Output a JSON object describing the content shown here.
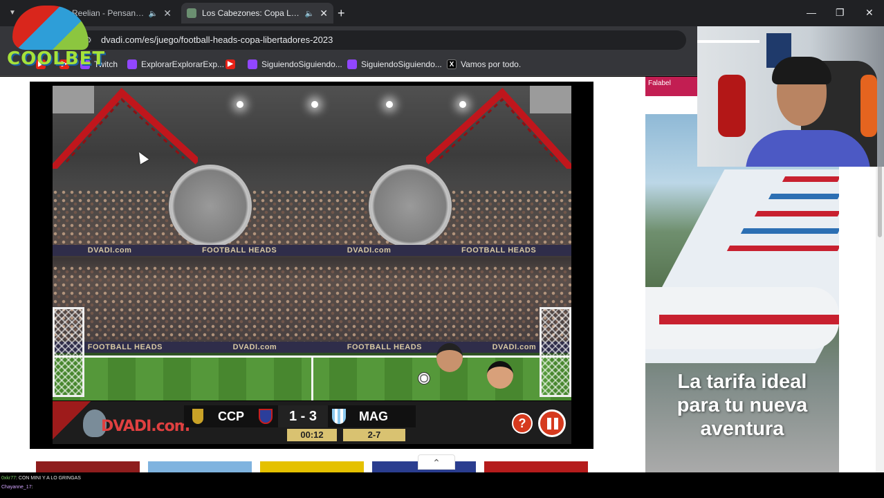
{
  "browser": {
    "tabs": [
      {
        "title": "Reelian - Pensando",
        "active": false
      },
      {
        "title": "Los Cabezones: Copa Libert",
        "active": true
      }
    ],
    "url": "dvadi.com/es/juego/football-heads-copa-libertadores-2023",
    "bookmarks": [
      {
        "label": "Twitch",
        "icon": "twitch-icon",
        "color": "#9146ff"
      },
      {
        "label": "ExplorarExplorarExp...",
        "icon": "twitch-icon",
        "color": "#9146ff"
      },
      {
        "label": "SiguiendoSiguiendo...",
        "icon": "twitch-icon",
        "color": "#9146ff"
      },
      {
        "label": "SiguiendoSiguiendo...",
        "icon": "twitch-icon",
        "color": "#9146ff"
      },
      {
        "label": "Vamos por todo.",
        "icon": "x-icon",
        "color": "#000000"
      }
    ]
  },
  "game": {
    "adboard_text": [
      "DVADI.com",
      "FOOTBALL HEADS",
      "DVADI.com",
      "FOOTBALL HEADS"
    ],
    "brand": "DVADI.com",
    "home_team": "CCP",
    "score": "1 - 3",
    "away_team": "MAG",
    "time": "00:12",
    "round": "2-7",
    "help_symbol": "?"
  },
  "ad": {
    "top_text": "Falabel",
    "headline_line1": "La tarifa ideal",
    "headline_line2": "para tu nueva",
    "headline_line3": "aventura"
  },
  "overlay": {
    "logo_text": "COOLBET"
  },
  "chat": {
    "line1_user": "0xkr77",
    "line1_msg": ": CON MINI Y A LO GRINGAS",
    "line2_user": "Chayanne_17",
    "line2_msg": ":"
  },
  "colors": {
    "accent_red": "#d63a1e",
    "truss_red": "#c0161c",
    "timer_gold": "#d9c271"
  }
}
